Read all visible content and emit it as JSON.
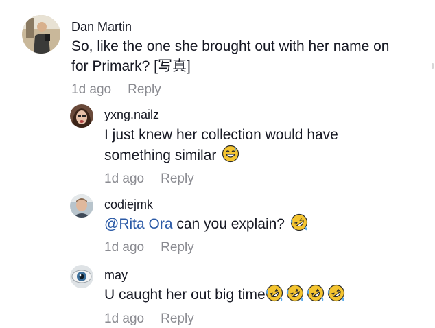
{
  "comments": [
    {
      "username": "Dan Martin",
      "text_line1": "So, like the one she brought out with her name on",
      "text_line2": "for Primark? [写真]",
      "time": "1d ago",
      "reply_label": "Reply",
      "avatar_icon": "person-photo-avatar"
    },
    {
      "username": "yxng.nailz",
      "text_line1": "I just knew her collection would have",
      "text_line2": "something similar",
      "emoji": "grinning-sweat-emoji",
      "time": "1d ago",
      "reply_label": "Reply",
      "avatar_icon": "person-photo-avatar"
    },
    {
      "username": "codiejmk",
      "mention": "@Rita Ora",
      "text": " can you explain?",
      "emoji": "rolling-laughing-emoji",
      "time": "1d ago",
      "reply_label": "Reply",
      "avatar_icon": "person-photo-avatar"
    },
    {
      "username": "may",
      "text": "U caught her out big time",
      "emoji": "rolling-laughing-emoji",
      "emoji_count": 4,
      "time": "1d ago",
      "reply_label": "Reply",
      "avatar_icon": "eye-photo-avatar"
    }
  ],
  "colors": {
    "text": "#161823",
    "meta": "#8a8b91",
    "mention": "#2b5aa6",
    "emoji_yellow": "#f4c430"
  }
}
